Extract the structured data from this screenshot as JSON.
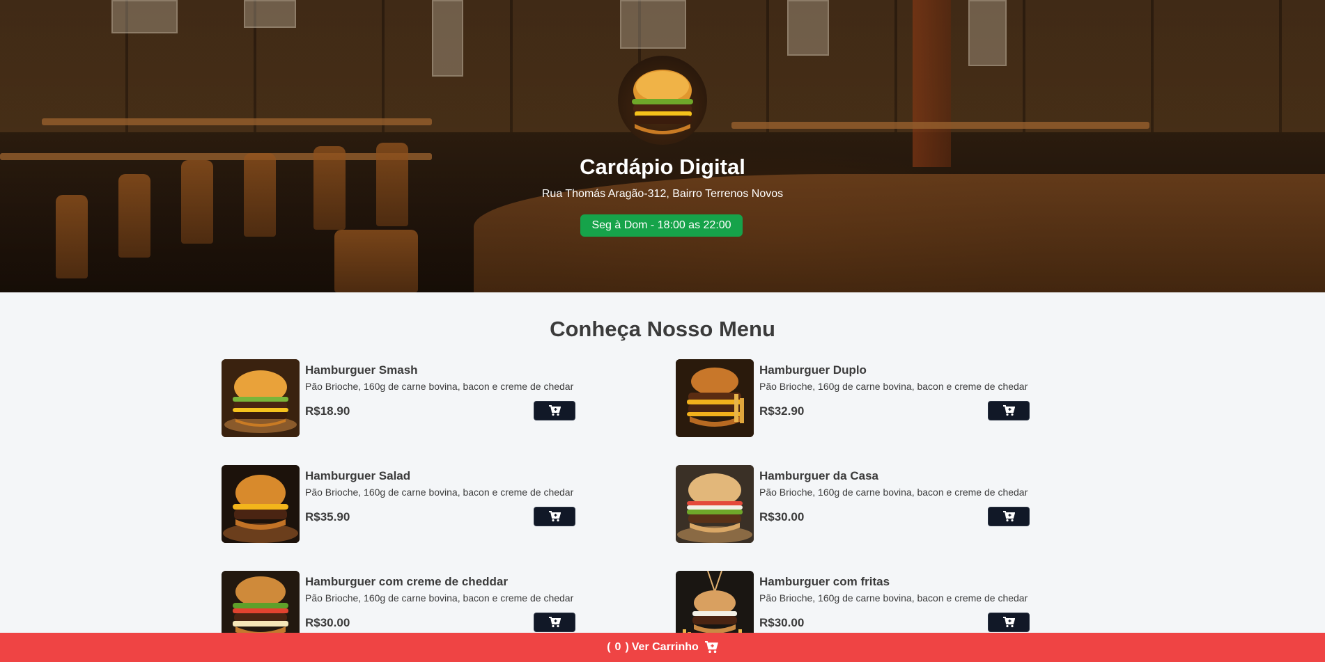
{
  "hero": {
    "title": "Cardápio Digital",
    "address": "Rua Thomás Aragão-312, Bairro Terrenos Novos",
    "hours": "Seg à Dom - 18:00 as 22:00",
    "hours_color": "#16a34a"
  },
  "menu": {
    "title": "Conheça Nosso Menu",
    "items": [
      {
        "name": "Hamburguer Smash",
        "desc": "Pão Brioche, 160g de carne bovina, bacon e creme de chedar",
        "price": "R$18.90"
      },
      {
        "name": "Hamburguer Duplo",
        "desc": "Pão Brioche, 160g de carne bovina, bacon e creme de chedar",
        "price": "R$32.90"
      },
      {
        "name": "Hamburguer Salad",
        "desc": "Pão Brioche, 160g de carne bovina, bacon e creme de chedar",
        "price": "R$35.90"
      },
      {
        "name": "Hamburguer da Casa",
        "desc": "Pão Brioche, 160g de carne bovina, bacon e creme de chedar",
        "price": "R$30.00"
      },
      {
        "name": "Hamburguer com creme de cheddar",
        "desc": "Pão Brioche, 160g de carne bovina, bacon e creme de chedar",
        "price": "R$30.00"
      },
      {
        "name": "Hamburguer com fritas",
        "desc": "Pão Brioche, 160g de carne bovina, bacon e creme de chedar",
        "price": "R$30.00"
      }
    ],
    "button_color": "#111827"
  },
  "cart": {
    "open_paren": "(",
    "count": "0",
    "close_paren": ")",
    "label": "Ver Carrinho",
    "bar_color": "#ef4444",
    "icon": "shopping-cart-icon"
  }
}
